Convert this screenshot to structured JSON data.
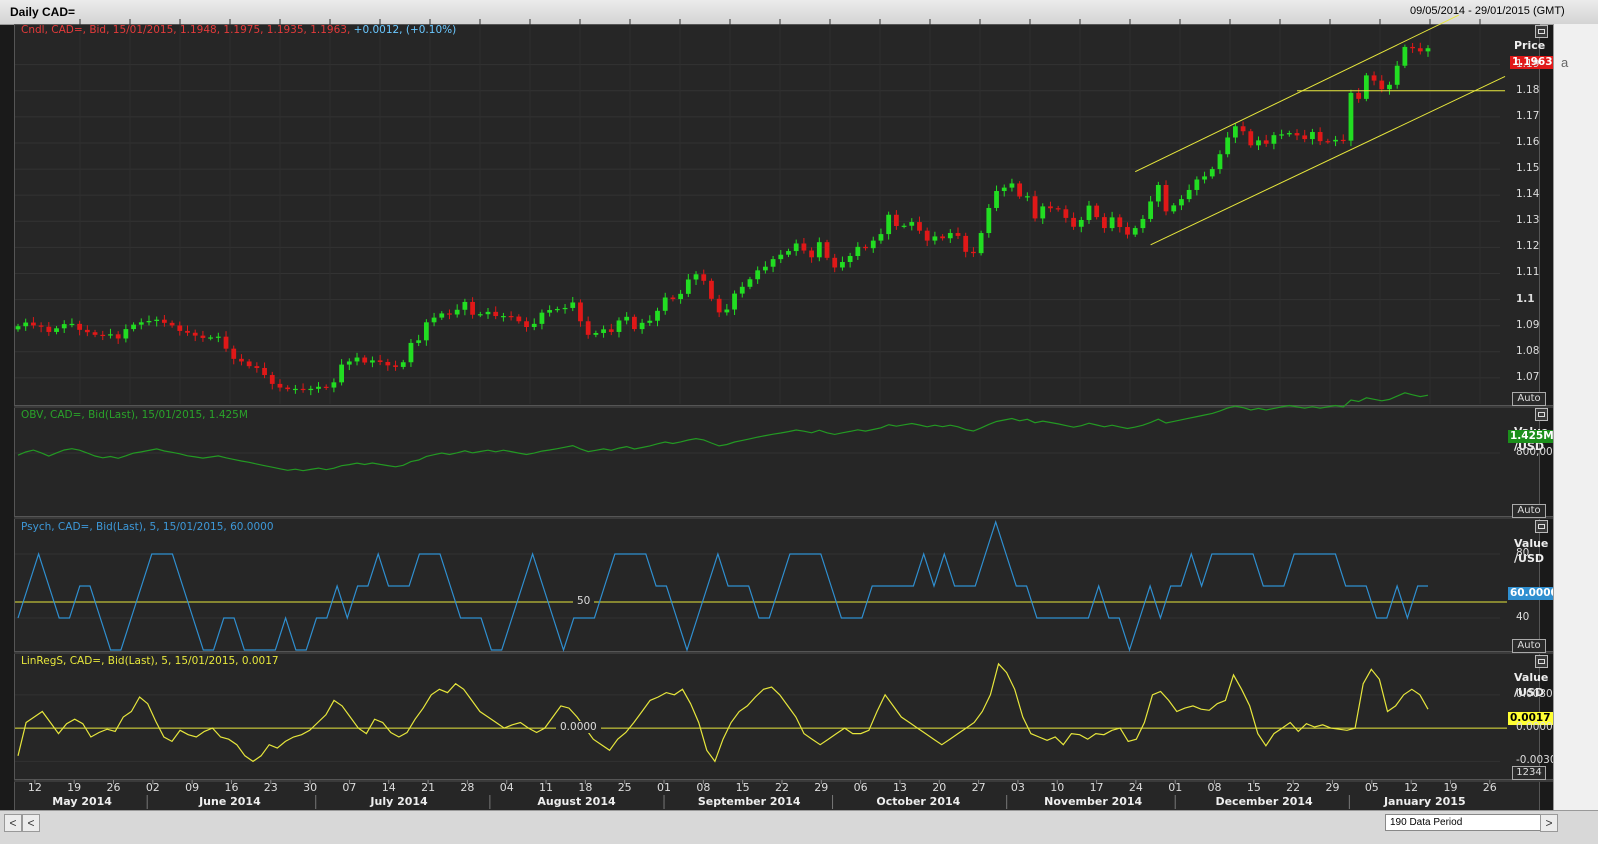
{
  "window": {
    "title": "Daily CAD=",
    "date_range": "09/05/2014 - 29/01/2015 (GMT)"
  },
  "colors": {
    "up_candle": "#22dd22",
    "down_candle": "#e01818",
    "trend_line": "#e6e63c",
    "obv_line": "#239923",
    "psych_line": "#2f8fd0",
    "linreg_line": "#e6e63c",
    "reference_line": "#e6e63c"
  },
  "scrollbar": {
    "period_label": "190 Data Period",
    "left_arrow": "<",
    "left_arrow2": "<",
    "right_arrow": ">"
  },
  "right_strip": {
    "fragment": "a"
  },
  "x_axis": {
    "day_labels": [
      "12",
      "19",
      "26",
      "02",
      "09",
      "16",
      "23",
      "30",
      "07",
      "14",
      "21",
      "28",
      "04",
      "11",
      "18",
      "25",
      "01",
      "08",
      "15",
      "22",
      "29",
      "06",
      "13",
      "20",
      "27",
      "03",
      "10",
      "17",
      "24",
      "01",
      "08",
      "15",
      "22",
      "29",
      "05",
      "12",
      "19",
      "26"
    ],
    "month_labels": [
      "May 2014",
      "June 2014",
      "July 2014",
      "August 2014",
      "September 2014",
      "October 2014",
      "November 2014",
      "December 2014",
      "January 2015"
    ]
  },
  "chart_data": [
    {
      "type": "candlestick",
      "title": "Cndl, CAD=, Bid, 15/01/2015, 1.1948, 1.1975, 1.1935, 1.1963,",
      "change_text": "+0.0012, (+0.10%)",
      "axis_header": "Price",
      "last_value_label": "1.1963",
      "auto_label": "Auto",
      "y_ticks": [
        "1.19",
        "1.18",
        "1.17",
        "1.16",
        "1.15",
        "1.14",
        "1.13",
        "1.12",
        "1.11",
        "1.1",
        "1.09",
        "1.08",
        "1.07"
      ],
      "ylim": [
        1.06,
        1.2075
      ],
      "x_range": [
        "2014-05-09",
        "2015-01-29"
      ],
      "last_date": "2015-01-15",
      "closes": [
        1.0898,
        1.0912,
        1.0901,
        1.0896,
        1.0876,
        1.089,
        1.0906,
        1.0907,
        1.0884,
        1.0875,
        1.0865,
        1.0863,
        1.0867,
        1.0851,
        1.0887,
        1.0904,
        1.0913,
        1.0918,
        1.0923,
        1.0911,
        1.0901,
        1.088,
        1.0873,
        1.0862,
        1.0853,
        1.0855,
        1.0858,
        1.0812,
        1.0773,
        1.0763,
        1.0745,
        1.0738,
        1.0711,
        1.0677,
        1.0663,
        1.0657,
        1.0658,
        1.0655,
        1.0658,
        1.0666,
        1.0663,
        1.0683,
        1.0751,
        1.0763,
        1.0778,
        1.0759,
        1.0767,
        1.0761,
        1.0748,
        1.0742,
        1.076,
        1.0834,
        1.0844,
        1.0913,
        1.0931,
        1.0947,
        1.0943,
        1.0961,
        1.0991,
        1.0942,
        1.0944,
        1.0953,
        1.0937,
        1.0937,
        1.0935,
        1.0917,
        1.0895,
        1.0907,
        1.095,
        1.096,
        1.0964,
        1.0968,
        1.0989,
        1.0917,
        1.0865,
        1.0872,
        1.0886,
        1.0876,
        1.092,
        1.0934,
        1.0887,
        1.0911,
        1.0919,
        1.0957,
        1.1008,
        1.1002,
        1.1022,
        1.1077,
        1.1097,
        1.1072,
        1.1003,
        1.0951,
        1.0962,
        1.1023,
        1.1049,
        1.1078,
        1.1112,
        1.1126,
        1.1155,
        1.1172,
        1.1186,
        1.1215,
        1.1188,
        1.1162,
        1.122,
        1.116,
        1.1123,
        1.1144,
        1.1167,
        1.1202,
        1.1197,
        1.1226,
        1.1251,
        1.1325,
        1.1282,
        1.1283,
        1.1297,
        1.1264,
        1.1226,
        1.1242,
        1.1235,
        1.1255,
        1.1244,
        1.1183,
        1.1178,
        1.1255,
        1.1351,
        1.1416,
        1.1429,
        1.1445,
        1.1395,
        1.1396,
        1.1311,
        1.1357,
        1.135,
        1.1346,
        1.1313,
        1.1279,
        1.1305,
        1.136,
        1.1316,
        1.1274,
        1.1315,
        1.1278,
        1.1249,
        1.1274,
        1.1309,
        1.1376,
        1.1439,
        1.1338,
        1.1361,
        1.1385,
        1.142,
        1.146,
        1.1472,
        1.15,
        1.1557,
        1.1621,
        1.1664,
        1.1645,
        1.1591,
        1.161,
        1.1597,
        1.163,
        1.1633,
        1.1638,
        1.1629,
        1.1615,
        1.1642,
        1.1607,
        1.1606,
        1.1612,
        1.1609,
        1.1792,
        1.1769,
        1.1859,
        1.1839,
        1.1806,
        1.1823,
        1.1896,
        1.1968,
        1.1963,
        1.1951,
        1.1963
      ]
    },
    {
      "type": "line",
      "title": "OBV, CAD=, Bid(Last), 15/01/2015, 1.425M",
      "axis_header": "Value",
      "axis_sub": "/USD",
      "last_value_label": "1.425M",
      "auto_label": "Auto",
      "y_ticks": [
        "800,000"
      ],
      "ylim": [
        -500000,
        1700000
      ],
      "series": [
        {
          "values": [
            752000,
            819000,
            859000,
            803000,
            735000,
            802000,
            861000,
            890000,
            857000,
            799000,
            736000,
            699000,
            726000,
            689000,
            741000,
            796000,
            822000,
            853000,
            884000,
            840000,
            814000,
            782000,
            741000,
            717000,
            692000,
            716000,
            738000,
            698000,
            666000,
            632000,
            605000,
            567000,
            533000,
            501000,
            469000,
            436000,
            460000,
            428000,
            455000,
            482000,
            450000,
            480000,
            533000,
            556000,
            588000,
            559000,
            589000,
            561000,
            536000,
            509000,
            542000,
            619000,
            652000,
            728000,
            764000,
            799000,
            768000,
            804000,
            845000,
            802000,
            830000,
            858000,
            825000,
            858000,
            828000,
            797000,
            767000,
            796000,
            838000,
            861000,
            889000,
            921000,
            955000,
            885000,
            828000,
            855000,
            885000,
            856000,
            901000,
            934000,
            883000,
            915000,
            948000,
            991000,
            1030000,
            999000,
            1031000,
            1071000,
            1101000,
            1074000,
            1008000,
            948000,
            978000,
            1030000,
            1064000,
            1096000,
            1133000,
            1163000,
            1192000,
            1218000,
            1248000,
            1281000,
            1256000,
            1223000,
            1277000,
            1223000,
            1189000,
            1222000,
            1252000,
            1286000,
            1258000,
            1291000,
            1328000,
            1391000,
            1360000,
            1390000,
            1418000,
            1386000,
            1349000,
            1382000,
            1351000,
            1381000,
            1349000,
            1290000,
            1259000,
            1326000,
            1399000,
            1459000,
            1491000,
            1521000,
            1473000,
            1505000,
            1434000,
            1468000,
            1439000,
            1409000,
            1374000,
            1340000,
            1372000,
            1423000,
            1386000,
            1349000,
            1382000,
            1345000,
            1313000,
            1342000,
            1381000,
            1441000,
            1508000,
            1427000,
            1461000,
            1495000,
            1528000,
            1562000,
            1595000,
            1629000,
            1682000,
            1742000,
            1781000,
            1751000,
            1700000,
            1733000,
            1700000,
            1734000,
            1764000,
            1795000,
            1765000,
            1737000,
            1770000,
            1737000,
            1766000,
            1795000,
            1763000,
            1910000,
            1878000,
            1955000,
            1924000,
            1892000,
            1922000,
            1991000,
            2060000,
            2018000,
            1980000,
            2010000
          ]
        }
      ]
    },
    {
      "type": "line",
      "title": "Psych, CAD=, Bid(Last),  5,  15/01/2015, 60.0000",
      "axis_header": "Value",
      "axis_sub": "/USD",
      "last_value_label": "60.0000",
      "reference_label": "50",
      "reference_value": 50,
      "auto_label": "Auto",
      "y_ticks": [
        "80",
        "40"
      ],
      "ylim": [
        20,
        100
      ],
      "series": [
        {
          "values": [
            40,
            60,
            80,
            60,
            40,
            40,
            60,
            60,
            40,
            20,
            20,
            40,
            60,
            80,
            80,
            80,
            60,
            40,
            20,
            20,
            40,
            40,
            20,
            20,
            20,
            20,
            40,
            20,
            20,
            40,
            40,
            60,
            40,
            60,
            60,
            80,
            60,
            60,
            60,
            80,
            80,
            80,
            60,
            40,
            40,
            40,
            20,
            20,
            40,
            60,
            80,
            60,
            40,
            20,
            40,
            40,
            40,
            60,
            80,
            80,
            80,
            80,
            60,
            60,
            40,
            20,
            40,
            60,
            80,
            60,
            60,
            60,
            40,
            40,
            60,
            80,
            80,
            80,
            80,
            60,
            40,
            40,
            40,
            60,
            60,
            60,
            60,
            60,
            80,
            60,
            80,
            60,
            60,
            60,
            80,
            100,
            80,
            60,
            60,
            40,
            40,
            40,
            40,
            40,
            40,
            60,
            40,
            40,
            20,
            40,
            60,
            40,
            60,
            60,
            80,
            60,
            80,
            80,
            80,
            80,
            80,
            60,
            60,
            60,
            80,
            80,
            80,
            80,
            80,
            60,
            60,
            60,
            40,
            40,
            60,
            40,
            60,
            60
          ]
        }
      ]
    },
    {
      "type": "line",
      "title": "LinRegS, CAD=, Bid(Last),  5,  15/01/2015, 0.0017",
      "axis_header": "Value",
      "axis_sub": "/USD",
      "last_value_label": "0.0017",
      "reference_label": "0.0000",
      "reference_value": 0,
      "axis_bottom_label": "1234",
      "y_ticks": [
        "0.0030",
        "0.0000",
        "-0.0030"
      ],
      "ylim": [
        -0.0045,
        0.0065
      ],
      "series": [
        {
          "values": [
            -0.0025,
            0.0005,
            0.001,
            0.0015,
            0.0005,
            -0.0005,
            0.0004,
            0.0008,
            0.0004,
            -0.0008,
            -0.0004,
            -0.0001,
            -0.0003,
            0.001,
            0.0015,
            0.0028,
            0.0022,
            0.0006,
            -0.0008,
            -0.0012,
            -0.0002,
            -0.0006,
            -0.0008,
            -0.0003,
            0.0,
            -0.0008,
            -0.001,
            -0.0015,
            -0.0025,
            -0.003,
            -0.0025,
            -0.0015,
            -0.0018,
            -0.0012,
            -0.0008,
            -0.0006,
            -0.0002,
            0.0005,
            0.0012,
            0.0025,
            0.002,
            0.001,
            0.0,
            -0.0005,
            0.0008,
            0.0005,
            -0.0004,
            -0.0008,
            -0.0004,
            0.0008,
            0.0018,
            0.003,
            0.0035,
            0.0032,
            0.004,
            0.0035,
            0.0025,
            0.0015,
            0.001,
            0.0005,
            0.0,
            0.0003,
            0.0005,
            0.0,
            -0.0004,
            0.0,
            0.001,
            0.002,
            0.0018,
            0.001,
            0.0,
            -0.001,
            -0.0015,
            -0.002,
            -0.001,
            -0.0004,
            0.0005,
            0.0015,
            0.0025,
            0.0028,
            0.0032,
            0.003,
            0.0035,
            0.0022,
            0.0005,
            -0.002,
            -0.003,
            -0.001,
            0.0005,
            0.0015,
            0.002,
            0.0028,
            0.0035,
            0.0037,
            0.003,
            0.002,
            0.001,
            -0.0005,
            -0.001,
            -0.0015,
            -0.001,
            -0.0005,
            0.0,
            -0.0005,
            -0.0005,
            -0.0002,
            0.0015,
            0.003,
            0.002,
            0.001,
            0.0005,
            0.0,
            -0.0005,
            -0.001,
            -0.0015,
            -0.001,
            -0.0005,
            0.0,
            0.0005,
            0.0015,
            0.003,
            0.0058,
            0.005,
            0.0035,
            0.001,
            -0.0005,
            -0.0008,
            -0.0011,
            -0.0008,
            -0.0015,
            -0.0005,
            -0.0006,
            -0.001,
            -0.0005,
            -0.0006,
            -0.0002,
            0.0,
            -0.0012,
            -0.001,
            0.0005,
            0.003,
            0.0033,
            0.0025,
            0.0015,
            0.0018,
            0.002,
            0.0017,
            0.0016,
            0.0022,
            0.0025,
            0.0048,
            0.0035,
            0.002,
            -0.0005,
            -0.0016,
            -0.0005,
            0.0,
            0.0005,
            -0.0003,
            0.0004,
            0.0001,
            0.0003,
            0.0,
            -0.0001,
            -0.0002,
            0.0,
            0.004,
            0.0053,
            0.0044,
            0.0015,
            0.002,
            0.003,
            0.0035,
            0.003,
            0.0017
          ]
        }
      ]
    }
  ]
}
